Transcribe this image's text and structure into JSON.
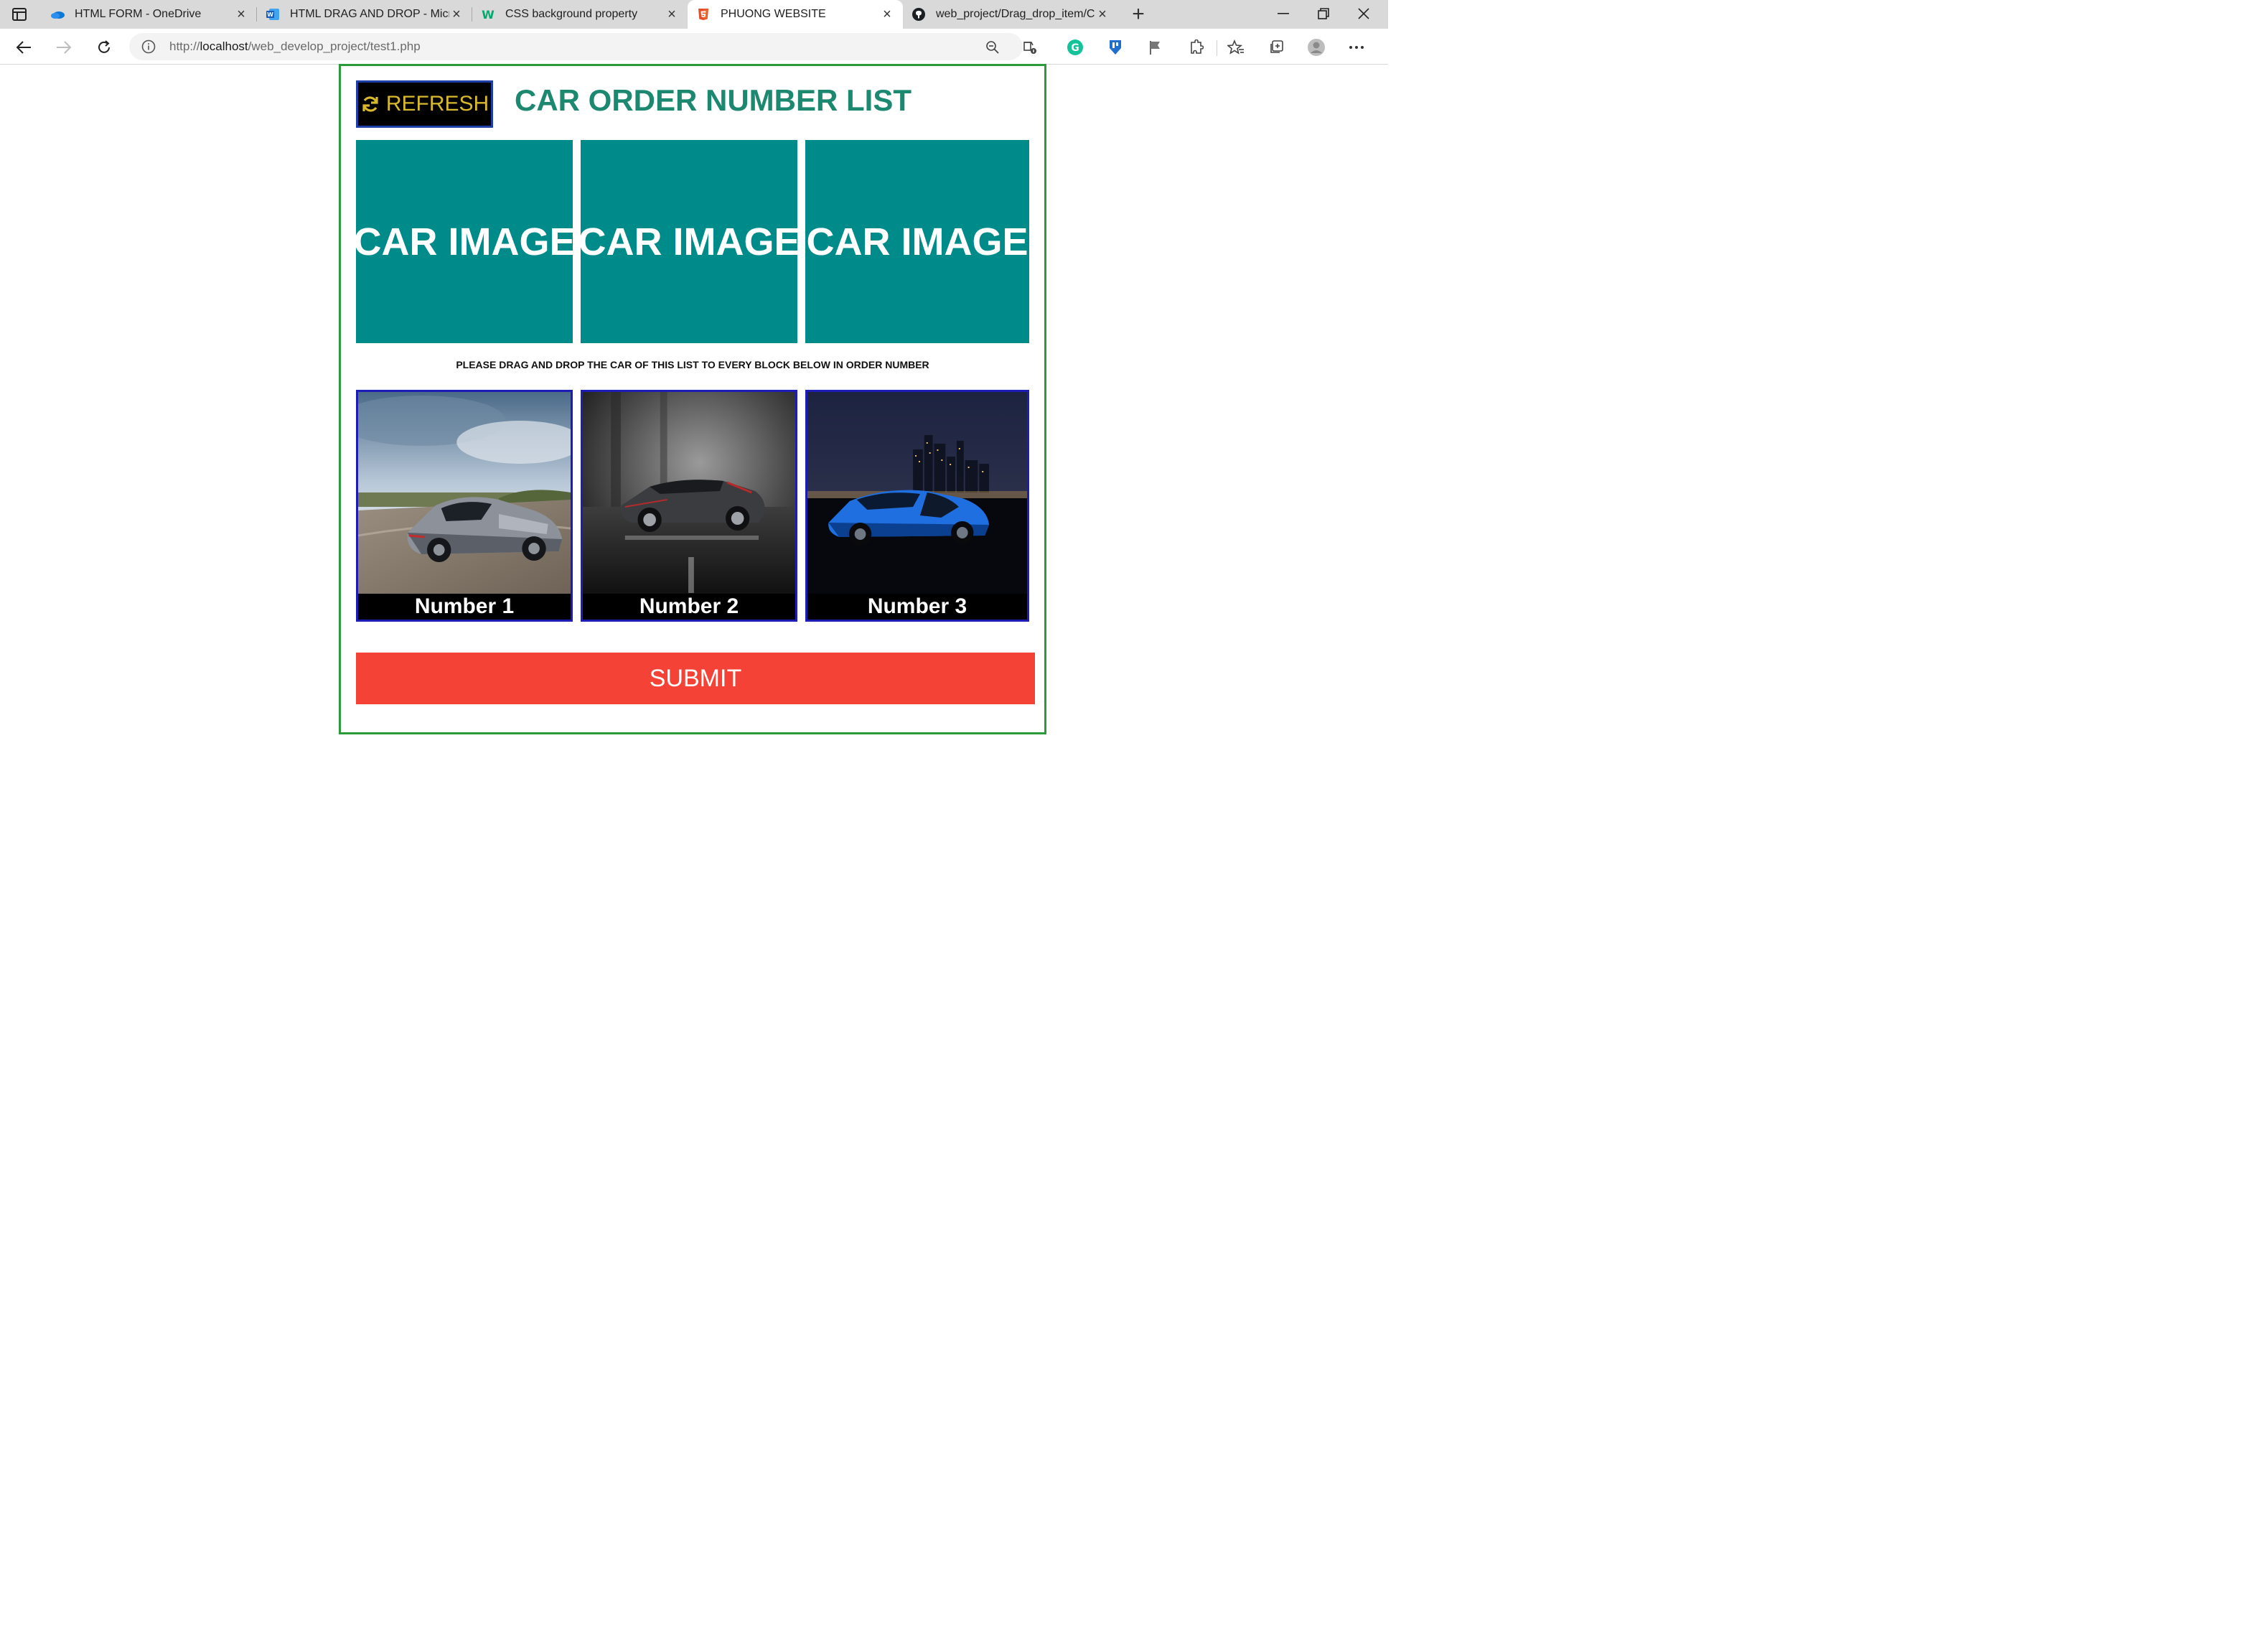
{
  "browser": {
    "tabs": [
      {
        "title": "HTML FORM - OneDrive",
        "icon": "onedrive-icon",
        "active": false
      },
      {
        "title": "HTML DRAG AND DROP - Micro",
        "icon": "word-icon",
        "active": false
      },
      {
        "title": "CSS background property",
        "icon": "w3schools-icon",
        "active": false
      },
      {
        "title": "PHUONG WEBSITE",
        "icon": "html5-icon",
        "active": true
      },
      {
        "title": "web_project/Drag_drop_item/Ca",
        "icon": "github-icon",
        "active": false
      }
    ],
    "address": {
      "scheme": "http://",
      "host": "localhost",
      "path": "/web_develop_project/test1.php"
    }
  },
  "page": {
    "refresh_label": "REFRESH",
    "title": "CAR ORDER NUMBER LIST",
    "source_items": [
      {
        "label": "CAR IMAGE"
      },
      {
        "label": "CAR IMAGE"
      },
      {
        "label": "CAR IMAGE"
      }
    ],
    "instruction": "PLEASE DRAG AND DROP THE CAR OF THIS LIST TO EVERY BLOCK BELOW IN ORDER NUMBER",
    "targets": [
      {
        "label": "Number 1"
      },
      {
        "label": "Number 2"
      },
      {
        "label": "Number 3"
      }
    ],
    "submit_label": "SUBMIT"
  },
  "colors": {
    "card_border": "#2e9b3a",
    "title": "#1d8870",
    "source_box": "#008b8b",
    "refresh_text": "#d9b92b",
    "submit": "#f44336",
    "target_border": "#1d1db5"
  }
}
